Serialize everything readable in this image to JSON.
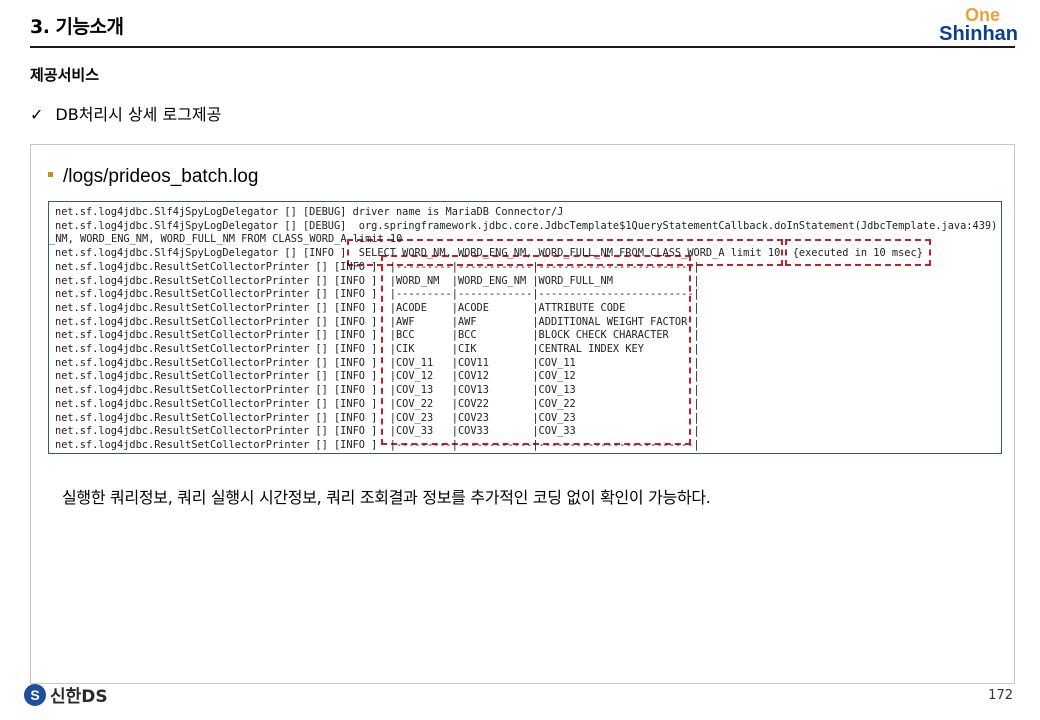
{
  "header": {
    "title": "3. 기능소개",
    "logo_top": "One",
    "logo_main": "Shinhan"
  },
  "section_title": "제공서비스",
  "bullet": {
    "check_glyph": "✓",
    "text": "DB처리시 상세 로그제공"
  },
  "log_panel": {
    "file_path": "/logs/prideos_batch.log",
    "lines": [
      "net.sf.log4jdbc.Slf4jSpyLogDelegator [] [DEBUG] driver name is MariaDB Connector/J",
      "net.sf.log4jdbc.Slf4jSpyLogDelegator [] [DEBUG]  org.springframework.jdbc.core.JdbcTemplate$1QueryStatementCallback.doInStatement(JdbcTemplate.java:439)",
      "_NM, WORD_ENG_NM, WORD_FULL_NM FROM CLASS_WORD_A limit 10",
      "net.sf.log4jdbc.Slf4jSpyLogDelegator [] [INFO ]  SELECT WORD_NM, WORD_ENG_NM, WORD_FULL_NM FROM CLASS_WORD_A limit 10  {executed in 10 msec}",
      "net.sf.log4jdbc.ResultSetCollectorPrinter [] [INFO ]  |---------|------------|-------------------------|",
      "net.sf.log4jdbc.ResultSetCollectorPrinter [] [INFO ]  |WORD_NM  |WORD_ENG_NM |WORD_FULL_NM             |",
      "net.sf.log4jdbc.ResultSetCollectorPrinter [] [INFO ]  |---------|------------|-------------------------|",
      "net.sf.log4jdbc.ResultSetCollectorPrinter [] [INFO ]  |ACODE    |ACODE       |ATTRIBUTE CODE           |",
      "net.sf.log4jdbc.ResultSetCollectorPrinter [] [INFO ]  |AWF      |AWF         |ADDITIONAL WEIGHT FACTOR |",
      "net.sf.log4jdbc.ResultSetCollectorPrinter [] [INFO ]  |BCC      |BCC         |BLOCK CHECK CHARACTER    |",
      "net.sf.log4jdbc.ResultSetCollectorPrinter [] [INFO ]  |CIK      |CIK         |CENTRAL INDEX KEY        |",
      "net.sf.log4jdbc.ResultSetCollectorPrinter [] [INFO ]  |COV_11   |COV11       |COV_11                   |",
      "net.sf.log4jdbc.ResultSetCollectorPrinter [] [INFO ]  |COV_12   |COV12       |COV_12                   |",
      "net.sf.log4jdbc.ResultSetCollectorPrinter [] [INFO ]  |COV_13   |COV13       |COV_13                   |",
      "net.sf.log4jdbc.ResultSetCollectorPrinter [] [INFO ]  |COV_22   |COV22       |COV_22                   |",
      "net.sf.log4jdbc.ResultSetCollectorPrinter [] [INFO ]  |COV_23   |COV23       |COV_23                   |",
      "net.sf.log4jdbc.ResultSetCollectorPrinter [] [INFO ]  |COV_33   |COV33       |COV_33                   |",
      "net.sf.log4jdbc.ResultSetCollectorPrinter [] [INFO ]  |---------|------------|-------------------------|"
    ],
    "highlight_color": "#c41f2a"
  },
  "description": "실행한 쿼리정보, 쿼리 실행시 시간정보,  쿼리 조회결과 정보를 추가적인 코딩 없이 확인이 가능하다.",
  "footer": {
    "logo_mark": "S",
    "logo_text": "신한DS",
    "page_number": "172"
  }
}
